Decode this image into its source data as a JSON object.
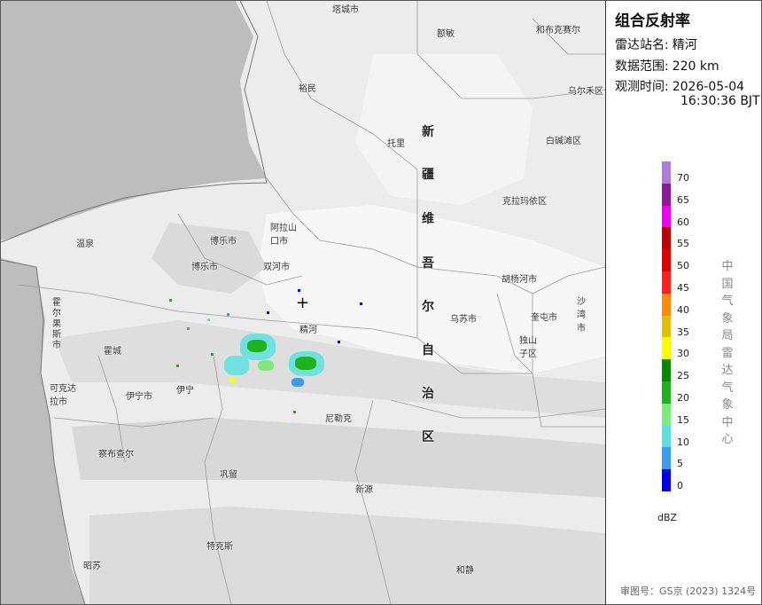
{
  "panel": {
    "title": "组合反射率",
    "station_key": "雷达站名:",
    "station_value": "精河",
    "range_key": "数据范围:",
    "range_value": "220 km",
    "time_key": "观测时间:",
    "time_date": "2026-05-04",
    "time_clock": "16:30:36 BJT"
  },
  "legend": {
    "unit": "dBZ",
    "ticks": [
      "70",
      "65",
      "60",
      "55",
      "50",
      "45",
      "40",
      "35",
      "30",
      "25",
      "20",
      "15",
      "10",
      "5",
      "0"
    ],
    "colors": [
      "#b07cdc",
      "#8b1a9c",
      "#f000f0",
      "#c00000",
      "#e00000",
      "#ff2020",
      "#ff8c00",
      "#e0c000",
      "#ffff00",
      "#008800",
      "#1fb21f",
      "#7de87d",
      "#5ee0e0",
      "#3c9cf0",
      "#0000f0"
    ]
  },
  "org_text": "中国气象局雷达气象中心",
  "approval": "审图号：GS京 (2023) 1324号",
  "places": {
    "tacheng": "塔城市",
    "hefeng": "和布克赛尔",
    "wuerhe": "乌尔禾区",
    "emin": "额敏",
    "yumin": "裕民",
    "tuoli": "托里",
    "baijiantan": "白碱滩区",
    "kelamayi": "克拉玛依区",
    "wenquan": "温泉",
    "bole": "博乐市",
    "alashankou": "阿拉山口市",
    "shuanghe": "双河市",
    "kuitun": "奎屯市",
    "dushanzi": "独山子区",
    "huyanghe": "胡杨河市",
    "kuitun_city": "奎屯市",
    "wusu": "乌苏市",
    "shawan": "沙湾市",
    "jinghe": "精河",
    "huocheng": "霍城",
    "horgos": "霍尔果斯市",
    "yining_city": "伊宁市",
    "yining": "伊宁",
    "kokdala": "可克达拉市",
    "chabuchaer": "察布查尔",
    "nileke": "尼勒克",
    "gongliu": "巩留",
    "xinyuan": "新源",
    "tekesi": "特克斯",
    "zhaosu": "昭苏",
    "hejing": "和静",
    "region_chars": [
      "新",
      "疆",
      "维",
      "吾",
      "尔",
      "自",
      "治",
      "区"
    ]
  }
}
